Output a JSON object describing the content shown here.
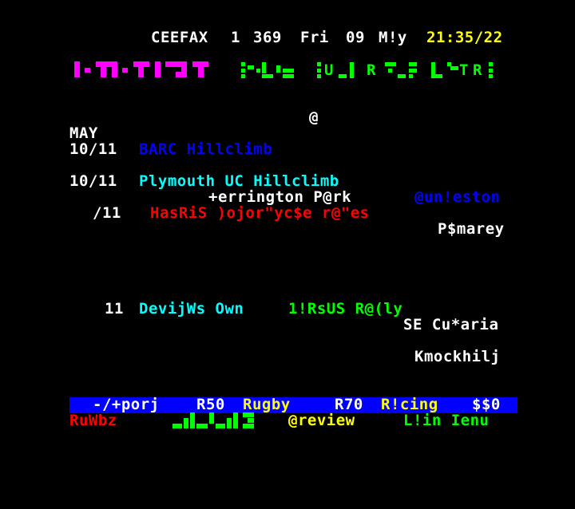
{
  "header": {
    "service": "CEEFAX",
    "channel": "1",
    "page": "369",
    "day": "Fri",
    "date": "09",
    "month": "M!y",
    "time": "21:35/22"
  },
  "title_graphics": {
    "left_logo_color": "#ff00ff",
    "right_banner_color": "#00ff00",
    "right_banner_letters": "U R T R"
  },
  "at_symbol": "@",
  "month_heading": "MAY",
  "events": [
    {
      "date": "10/11",
      "name": "BARC Hillclimb"
    },
    {
      "date": "10/11",
      "name": "Plymouth UC Hillclimb",
      "venue": "+errington P@rk",
      "location": "@un!eston"
    },
    {
      "date": "/11",
      "name": "HasRiS )ojor\"yc$e r@\"es",
      "location": "P$marey"
    },
    {
      "date": "11",
      "name": "DevijWs Own",
      "extra": "1!RsUS R@(ly",
      "location": "SE Cu*aria",
      "location2": "Kmockhilj"
    }
  ],
  "nav_bar": {
    "prev_next": "-/+porj",
    "r50": "R50",
    "rugby": "Rugby",
    "r70": "R70",
    "racing": "R!cing",
    "p80": "$$0"
  },
  "fastext": {
    "red": "RuWbz",
    "yellow": "@review",
    "cyan": "L!in Ienu"
  },
  "colors": {
    "background": "#000000",
    "white": "#ffffff",
    "yellow": "#ffff00",
    "cyan": "#00ffff",
    "green": "#00ff00",
    "red": "#ff0000",
    "blue": "#0000ff",
    "magenta": "#ff00ff"
  }
}
